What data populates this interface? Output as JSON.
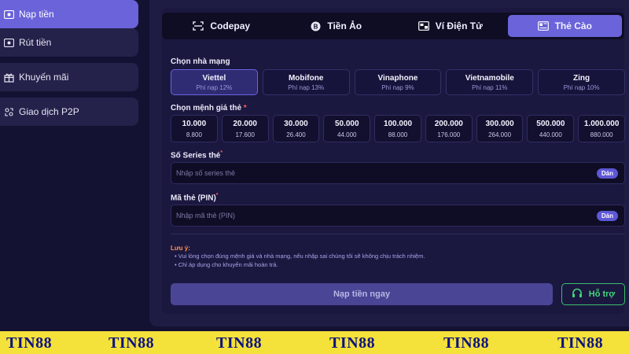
{
  "sidebar": {
    "items": [
      {
        "label": "Nạp tiền",
        "icon": "deposit-icon",
        "active": true
      },
      {
        "label": "Rút tiền",
        "icon": "withdraw-icon",
        "active": false
      },
      {
        "label": "Khuyến mãi",
        "icon": "gift-icon",
        "active": false
      },
      {
        "label": "Giao dịch P2P",
        "icon": "p2p-icon",
        "active": false
      }
    ]
  },
  "tabs": [
    {
      "label": "Codepay",
      "icon": "codepay-icon",
      "active": false
    },
    {
      "label": "Tiền Ảo",
      "icon": "bitcoin-icon",
      "active": false
    },
    {
      "label": "Ví Điện Tử",
      "icon": "wallet-icon",
      "active": false
    },
    {
      "label": "Thẻ Cào",
      "icon": "card-icon",
      "active": true
    }
  ],
  "network": {
    "label": "Chọn nhà mạng",
    "options": [
      {
        "name": "Viettel",
        "fee": "Phí nạp 12%",
        "selected": true
      },
      {
        "name": "Mobifone",
        "fee": "Phí nạp 13%",
        "selected": false
      },
      {
        "name": "Vinaphone",
        "fee": "Phí nạp 9%",
        "selected": false
      },
      {
        "name": "Vietnamobile",
        "fee": "Phí nạp 11%",
        "selected": false
      },
      {
        "name": "Zing",
        "fee": "Phí nạp 10%",
        "selected": false
      }
    ]
  },
  "denomination": {
    "label": "Chọn mệnh giá thẻ",
    "required": "*",
    "options": [
      {
        "value": "10.000",
        "receive": "8.800"
      },
      {
        "value": "20.000",
        "receive": "17.600"
      },
      {
        "value": "30.000",
        "receive": "26.400"
      },
      {
        "value": "50.000",
        "receive": "44.000"
      },
      {
        "value": "100.000",
        "receive": "88.000"
      },
      {
        "value": "200.000",
        "receive": "176.000"
      },
      {
        "value": "300.000",
        "receive": "264.000"
      },
      {
        "value": "500.000",
        "receive": "440.000"
      },
      {
        "value": "1.000.000",
        "receive": "880.000"
      }
    ]
  },
  "serial": {
    "label": "Số Series thẻ",
    "required": "*",
    "placeholder": "Nhập số series thẻ",
    "value": "",
    "paste_label": "Dán"
  },
  "pin": {
    "label": "Mã thẻ (PIN)",
    "required": "*",
    "placeholder": "Nhập mã thẻ (PIN)",
    "value": "",
    "paste_label": "Dán"
  },
  "notes": {
    "title": "Lưu ý:",
    "items": [
      "Vui lòng chọn đúng mệnh giá và nhà mạng, nếu nhập sai chúng tôi sẽ không chịu trách nhiệm.",
      "Chỉ áp dụng cho khuyến mãi hoàn trả."
    ]
  },
  "actions": {
    "submit_label": "Nạp tiền ngay",
    "support_label": "Hỗ trợ",
    "support_icon": "headphones-icon"
  },
  "watermark": {
    "text": "TIN88",
    "count": 6
  },
  "colors": {
    "accent": "#6a63d9",
    "support": "#43d779",
    "warning": "#ff8f4a",
    "strip": "#f4e13a"
  }
}
